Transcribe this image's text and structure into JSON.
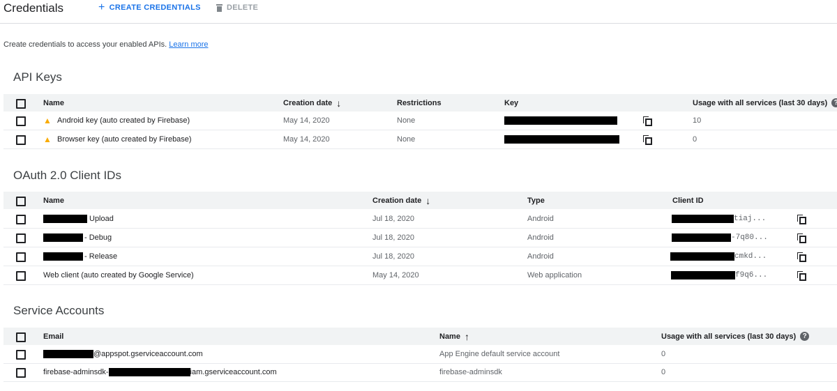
{
  "header": {
    "title": "Credentials",
    "create_label": "CREATE CREDENTIALS",
    "delete_label": "DELETE"
  },
  "description": {
    "text": "Create credentials to access your enabled APIs.",
    "link": "Learn more"
  },
  "api_keys": {
    "title": "API Keys",
    "columns": [
      "Name",
      "Creation date",
      "Restrictions",
      "Key",
      "Usage with all services (last 30 days)"
    ],
    "rows": [
      {
        "name": "Android key (auto created by Firebase)",
        "date": "May 14, 2020",
        "restrictions": "None",
        "usage": "10"
      },
      {
        "name": "Browser key (auto created by Firebase)",
        "date": "May 14, 2020",
        "restrictions": "None",
        "usage": "0"
      }
    ]
  },
  "oauth": {
    "title": "OAuth 2.0 Client IDs",
    "columns": [
      "Name",
      "Creation date",
      "Type",
      "Client ID"
    ],
    "rows": [
      {
        "name": "Upload",
        "date": "Jul 18, 2020",
        "type": "Android",
        "client_suffix": "tiaj..."
      },
      {
        "name": "- Debug",
        "date": "Jul 18, 2020",
        "type": "Android",
        "client_suffix": "-7q80..."
      },
      {
        "name": "- Release",
        "date": "Jul 18, 2020",
        "type": "Android",
        "client_suffix": "cmkd..."
      },
      {
        "name": "Web client (auto created by Google Service)",
        "date": "May 14, 2020",
        "type": "Web application",
        "client_suffix": "f9q6..."
      }
    ]
  },
  "service_accounts": {
    "title": "Service Accounts",
    "columns": [
      "Email",
      "Name",
      "Usage with all services (last 30 days)"
    ],
    "rows": [
      {
        "email_prefix": "",
        "email_suffix": "@appspot.gserviceaccount.com",
        "name": "App Engine default service account",
        "usage": "0"
      },
      {
        "email_prefix": "firebase-adminsdk-",
        "email_suffix": "iam.gserviceaccount.com",
        "name": "firebase-adminsdk",
        "usage": "0"
      }
    ]
  },
  "icons": {
    "add": "plus-icon",
    "delete": "trash-icon",
    "sort_desc": "arrow-down-icon",
    "sort_asc": "arrow-up-icon",
    "warning": "warning-icon",
    "copy": "copy-icon",
    "help": "help-icon"
  },
  "colors": {
    "accent": "#1a73e8",
    "warning": "#f9ab00",
    "header_bg": "#f1f3f4"
  }
}
